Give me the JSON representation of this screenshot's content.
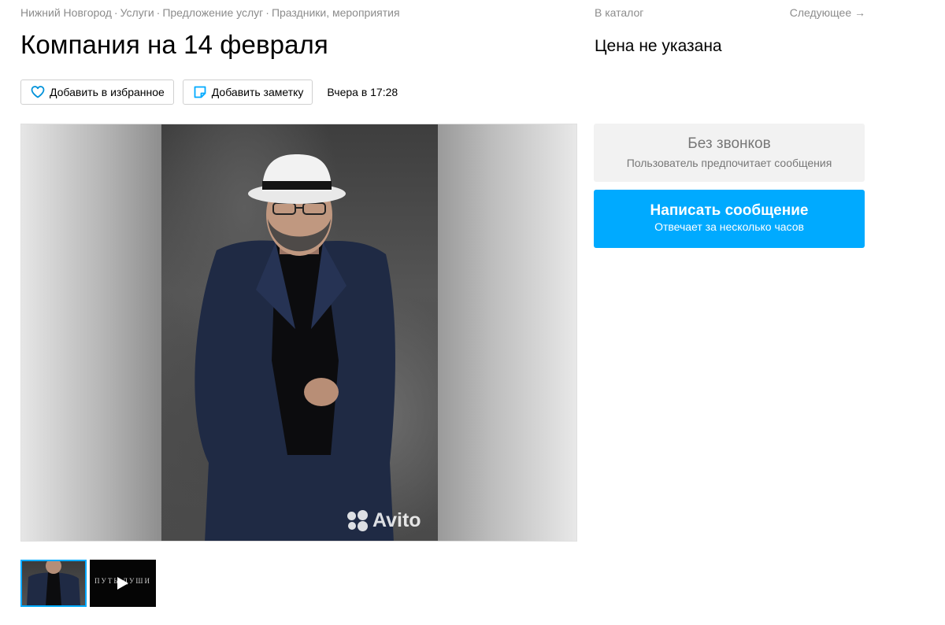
{
  "breadcrumb": {
    "items": [
      "Нижний Новгород",
      "Услуги",
      "Предложение услуг",
      "Праздники, мероприятия"
    ],
    "separator": "·"
  },
  "nav": {
    "catalog": "В каталог",
    "next": "Следующее →"
  },
  "listing": {
    "title": "Компания на 14 февраля",
    "price": "Цена не указана",
    "posted": "Вчера в 17:28"
  },
  "actions": {
    "favorite": "Добавить в избранное",
    "note": "Добавить заметку"
  },
  "photo": {
    "watermark": "Avito"
  },
  "thumbnails": {
    "video_caption": "ПУТЬ ДУШИ"
  },
  "contact": {
    "no_calls_title": "Без звонков",
    "no_calls_subtitle": "Пользователь предпочитает сообщения",
    "message_title": "Написать сообщение",
    "message_subtitle": "Отвечает за несколько часов"
  },
  "colors": {
    "accent": "#00aaff",
    "muted_text": "#8c8c8c",
    "icon_blue": "#0091d9",
    "note_icon": "#00aaff"
  }
}
